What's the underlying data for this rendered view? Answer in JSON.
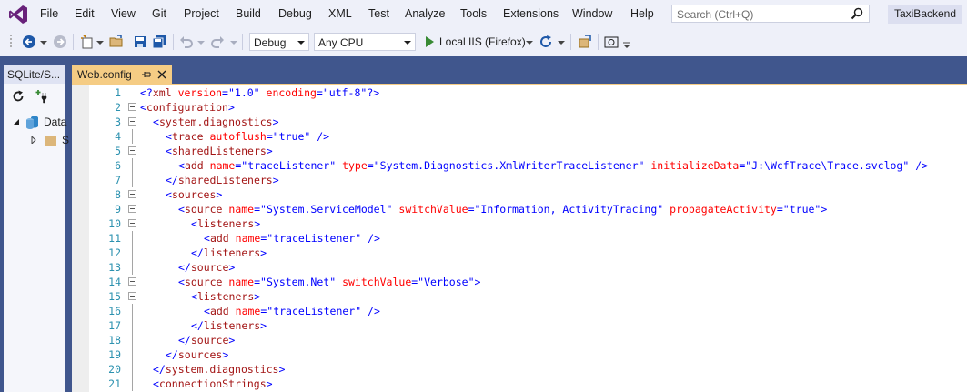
{
  "menu": {
    "items": [
      "File",
      "Edit",
      "View",
      "Git",
      "Project",
      "Build",
      "Debug",
      "XML",
      "Test",
      "Analyze",
      "Tools",
      "Extensions",
      "Window",
      "Help"
    ],
    "search_placeholder": "Search (Ctrl+Q)",
    "solution_name": "TaxiBackend"
  },
  "toolbar": {
    "config": "Debug",
    "platform": "Any CPU",
    "run_target": "Local IIS (Firefox)"
  },
  "left_panel": {
    "tab_label": "SQLite/S...",
    "tree": [
      {
        "label": "Data",
        "expanded": true
      },
      {
        "label": "S",
        "expanded": false
      }
    ]
  },
  "editor": {
    "tab_label": "Web.config",
    "lines": [
      {
        "n": "1",
        "indent": 0,
        "parts": [
          [
            "br",
            "<?"
          ],
          [
            "el",
            "xml"
          ],
          [
            "at",
            " version"
          ],
          [
            "br",
            "=\""
          ],
          [
            "va",
            "1.0"
          ],
          [
            "br",
            "\""
          ],
          [
            "at",
            " encoding"
          ],
          [
            "br",
            "=\""
          ],
          [
            "va",
            "utf-8"
          ],
          [
            "br",
            "\"?>"
          ]
        ]
      },
      {
        "n": "2",
        "indent": 0,
        "parts": [
          [
            "br",
            "<"
          ],
          [
            "el",
            "configuration"
          ],
          [
            "br",
            ">"
          ]
        ]
      },
      {
        "n": "3",
        "indent": 1,
        "parts": [
          [
            "br",
            "<"
          ],
          [
            "el",
            "system.diagnostics"
          ],
          [
            "br",
            ">"
          ]
        ]
      },
      {
        "n": "4",
        "indent": 2,
        "parts": [
          [
            "br",
            "<"
          ],
          [
            "el",
            "trace"
          ],
          [
            "at",
            " autoflush"
          ],
          [
            "br",
            "=\""
          ],
          [
            "va",
            "true"
          ],
          [
            "br",
            "\" />"
          ]
        ]
      },
      {
        "n": "5",
        "indent": 2,
        "parts": [
          [
            "br",
            "<"
          ],
          [
            "el",
            "sharedListeners"
          ],
          [
            "br",
            ">"
          ]
        ]
      },
      {
        "n": "6",
        "indent": 3,
        "parts": [
          [
            "br",
            "<"
          ],
          [
            "el",
            "add"
          ],
          [
            "at",
            " name"
          ],
          [
            "br",
            "=\""
          ],
          [
            "va",
            "traceListener"
          ],
          [
            "br",
            "\""
          ],
          [
            "at",
            " type"
          ],
          [
            "br",
            "=\""
          ],
          [
            "va",
            "System.Diagnostics.XmlWriterTraceListener"
          ],
          [
            "br",
            "\""
          ],
          [
            "at",
            " initializeData"
          ],
          [
            "br",
            "=\""
          ],
          [
            "va",
            "J:\\WcfTrace\\Trace.svclog"
          ],
          [
            "br",
            "\" />"
          ]
        ]
      },
      {
        "n": "7",
        "indent": 2,
        "parts": [
          [
            "br",
            "</"
          ],
          [
            "el",
            "sharedListeners"
          ],
          [
            "br",
            ">"
          ]
        ]
      },
      {
        "n": "8",
        "indent": 2,
        "parts": [
          [
            "br",
            "<"
          ],
          [
            "el",
            "sources"
          ],
          [
            "br",
            ">"
          ]
        ]
      },
      {
        "n": "9",
        "indent": 3,
        "parts": [
          [
            "br",
            "<"
          ],
          [
            "el",
            "source"
          ],
          [
            "at",
            " name"
          ],
          [
            "br",
            "=\""
          ],
          [
            "va",
            "System.ServiceModel"
          ],
          [
            "br",
            "\""
          ],
          [
            "at",
            " switchValue"
          ],
          [
            "br",
            "=\""
          ],
          [
            "va",
            "Information, ActivityTracing"
          ],
          [
            "br",
            "\""
          ],
          [
            "at",
            " propagateActivity"
          ],
          [
            "br",
            "=\""
          ],
          [
            "va",
            "true"
          ],
          [
            "br",
            "\">"
          ]
        ]
      },
      {
        "n": "10",
        "indent": 4,
        "parts": [
          [
            "br",
            "<"
          ],
          [
            "el",
            "listeners"
          ],
          [
            "br",
            ">"
          ]
        ]
      },
      {
        "n": "11",
        "indent": 5,
        "parts": [
          [
            "br",
            "<"
          ],
          [
            "el",
            "add"
          ],
          [
            "at",
            " name"
          ],
          [
            "br",
            "=\""
          ],
          [
            "va",
            "traceListener"
          ],
          [
            "br",
            "\" />"
          ]
        ]
      },
      {
        "n": "12",
        "indent": 4,
        "parts": [
          [
            "br",
            "</"
          ],
          [
            "el",
            "listeners"
          ],
          [
            "br",
            ">"
          ]
        ]
      },
      {
        "n": "13",
        "indent": 3,
        "parts": [
          [
            "br",
            "</"
          ],
          [
            "el",
            "source"
          ],
          [
            "br",
            ">"
          ]
        ]
      },
      {
        "n": "14",
        "indent": 3,
        "parts": [
          [
            "br",
            "<"
          ],
          [
            "el",
            "source"
          ],
          [
            "at",
            " name"
          ],
          [
            "br",
            "=\""
          ],
          [
            "va",
            "System.Net"
          ],
          [
            "br",
            "\""
          ],
          [
            "at",
            " switchValue"
          ],
          [
            "br",
            "=\""
          ],
          [
            "va",
            "Verbose"
          ],
          [
            "br",
            "\">"
          ]
        ]
      },
      {
        "n": "15",
        "indent": 4,
        "parts": [
          [
            "br",
            "<"
          ],
          [
            "el",
            "listeners"
          ],
          [
            "br",
            ">"
          ]
        ]
      },
      {
        "n": "16",
        "indent": 5,
        "parts": [
          [
            "br",
            "<"
          ],
          [
            "el",
            "add"
          ],
          [
            "at",
            " name"
          ],
          [
            "br",
            "=\""
          ],
          [
            "va",
            "traceListener"
          ],
          [
            "br",
            "\" />"
          ]
        ]
      },
      {
        "n": "17",
        "indent": 4,
        "parts": [
          [
            "br",
            "</"
          ],
          [
            "el",
            "listeners"
          ],
          [
            "br",
            ">"
          ]
        ]
      },
      {
        "n": "18",
        "indent": 3,
        "parts": [
          [
            "br",
            "</"
          ],
          [
            "el",
            "source"
          ],
          [
            "br",
            ">"
          ]
        ]
      },
      {
        "n": "19",
        "indent": 2,
        "parts": [
          [
            "br",
            "</"
          ],
          [
            "el",
            "sources"
          ],
          [
            "br",
            ">"
          ]
        ]
      },
      {
        "n": "20",
        "indent": 1,
        "parts": [
          [
            "br",
            "</"
          ],
          [
            "el",
            "system.diagnostics"
          ],
          [
            "br",
            ">"
          ]
        ]
      },
      {
        "n": "21",
        "indent": 1,
        "parts": [
          [
            "br",
            "<"
          ],
          [
            "el",
            "connectionStrings"
          ],
          [
            "br",
            ">"
          ]
        ]
      }
    ]
  }
}
